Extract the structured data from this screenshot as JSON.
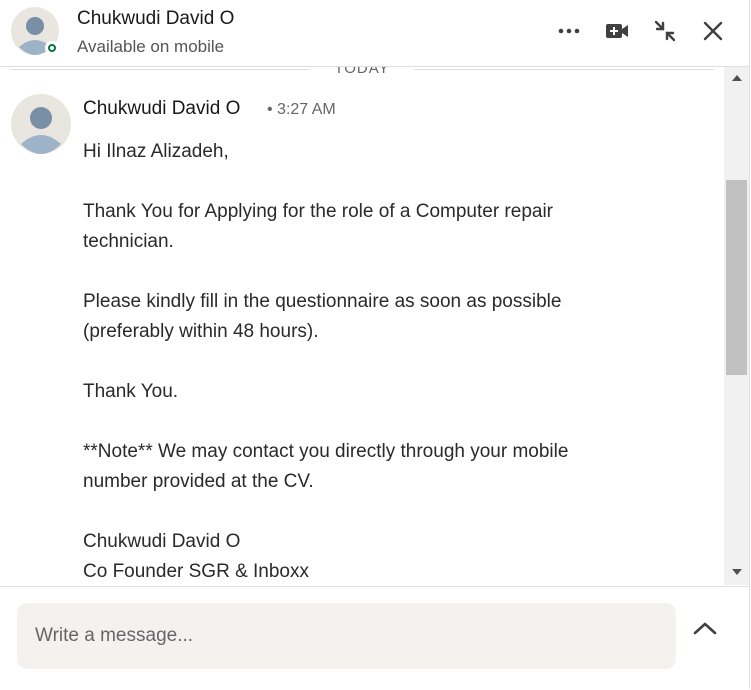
{
  "header": {
    "contact_name": "Chukwudi David O",
    "contact_status": "Available on mobile",
    "icons": [
      "more-options-icon",
      "video-call-icon",
      "minimize-icon",
      "close-icon"
    ],
    "presence_color": "#057642"
  },
  "thread": {
    "date_divider": "TODAY",
    "message": {
      "sender": "Chukwudi David O",
      "time": "• 3:27 AM",
      "lines": {
        "l1": "Hi Ilnaz Alizadeh,",
        "l2": "Thank You for Applying for the role of a Computer repair",
        "l3": "technician.",
        "l4": "Please kindly fill in the questionnaire as soon as possible",
        "l5": "(preferably within 48 hours).",
        "l6": "Thank You.",
        "l7": "**Note** We may contact you directly through your mobile",
        "l8": "number provided at the CV.",
        "l9": "Chukwudi David O",
        "l10": "Co Founder SGR & Inboxx"
      }
    }
  },
  "composer": {
    "placeholder": "Write a message..."
  }
}
